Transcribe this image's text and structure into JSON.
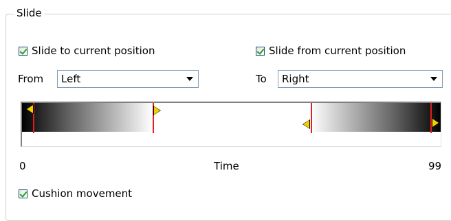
{
  "group": {
    "title": "Slide"
  },
  "checks": {
    "slide_to": {
      "label": "Slide to current position",
      "checked": true
    },
    "slide_from": {
      "label": "Slide from current position",
      "checked": true
    },
    "cushion": {
      "label": "Cushion movement",
      "checked": true
    }
  },
  "from": {
    "label": "From",
    "value": "Left"
  },
  "to": {
    "label": "To",
    "value": "Right"
  },
  "timeline": {
    "axis_label": "Time",
    "min_label": "0",
    "max_label": "99",
    "marker_colors": {
      "line": "#e02020",
      "handle": "#f1d000"
    }
  }
}
